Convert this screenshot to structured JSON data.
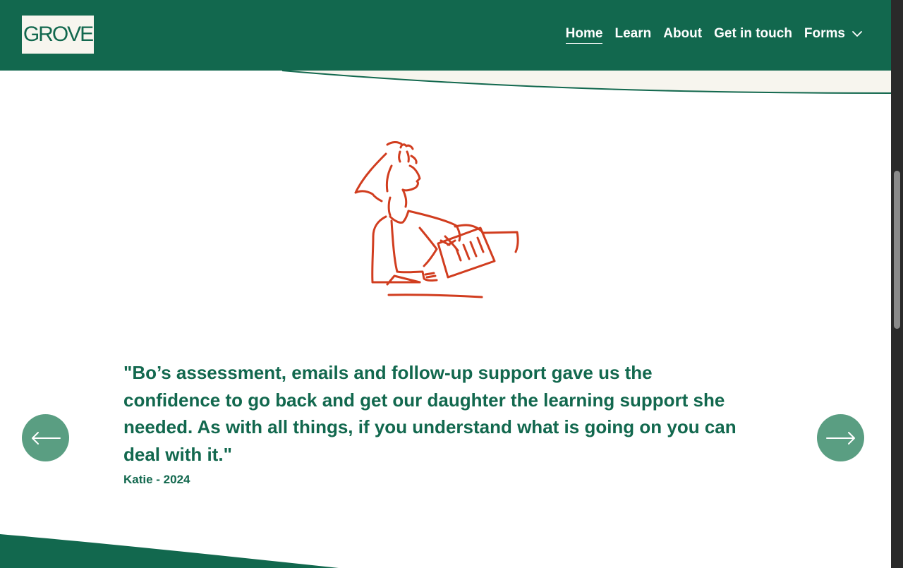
{
  "brand": {
    "logo_text": "GROVE",
    "primary_color": "#12684e",
    "accent_button_color": "#5a9e82",
    "illustration_color": "#d13d1f",
    "cream": "#f7f5ee"
  },
  "nav": {
    "items": [
      {
        "label": "Home",
        "active": true
      },
      {
        "label": "Learn",
        "active": false
      },
      {
        "label": "About",
        "active": false
      },
      {
        "label": "Get in touch",
        "active": false
      },
      {
        "label": "Forms",
        "active": false,
        "dropdown": true
      }
    ]
  },
  "testimonial": {
    "quote": "\"Bo’s assessment, emails and follow-up support gave us the confidence to go back and get our daughter the learning support she needed. As with all things, if you understand what is going on you can deal with it.\"",
    "author": "Katie - 2024",
    "illustration": "person-writing-illustration"
  },
  "carousel": {
    "prev_icon": "arrow-left-icon",
    "next_icon": "arrow-right-icon"
  }
}
